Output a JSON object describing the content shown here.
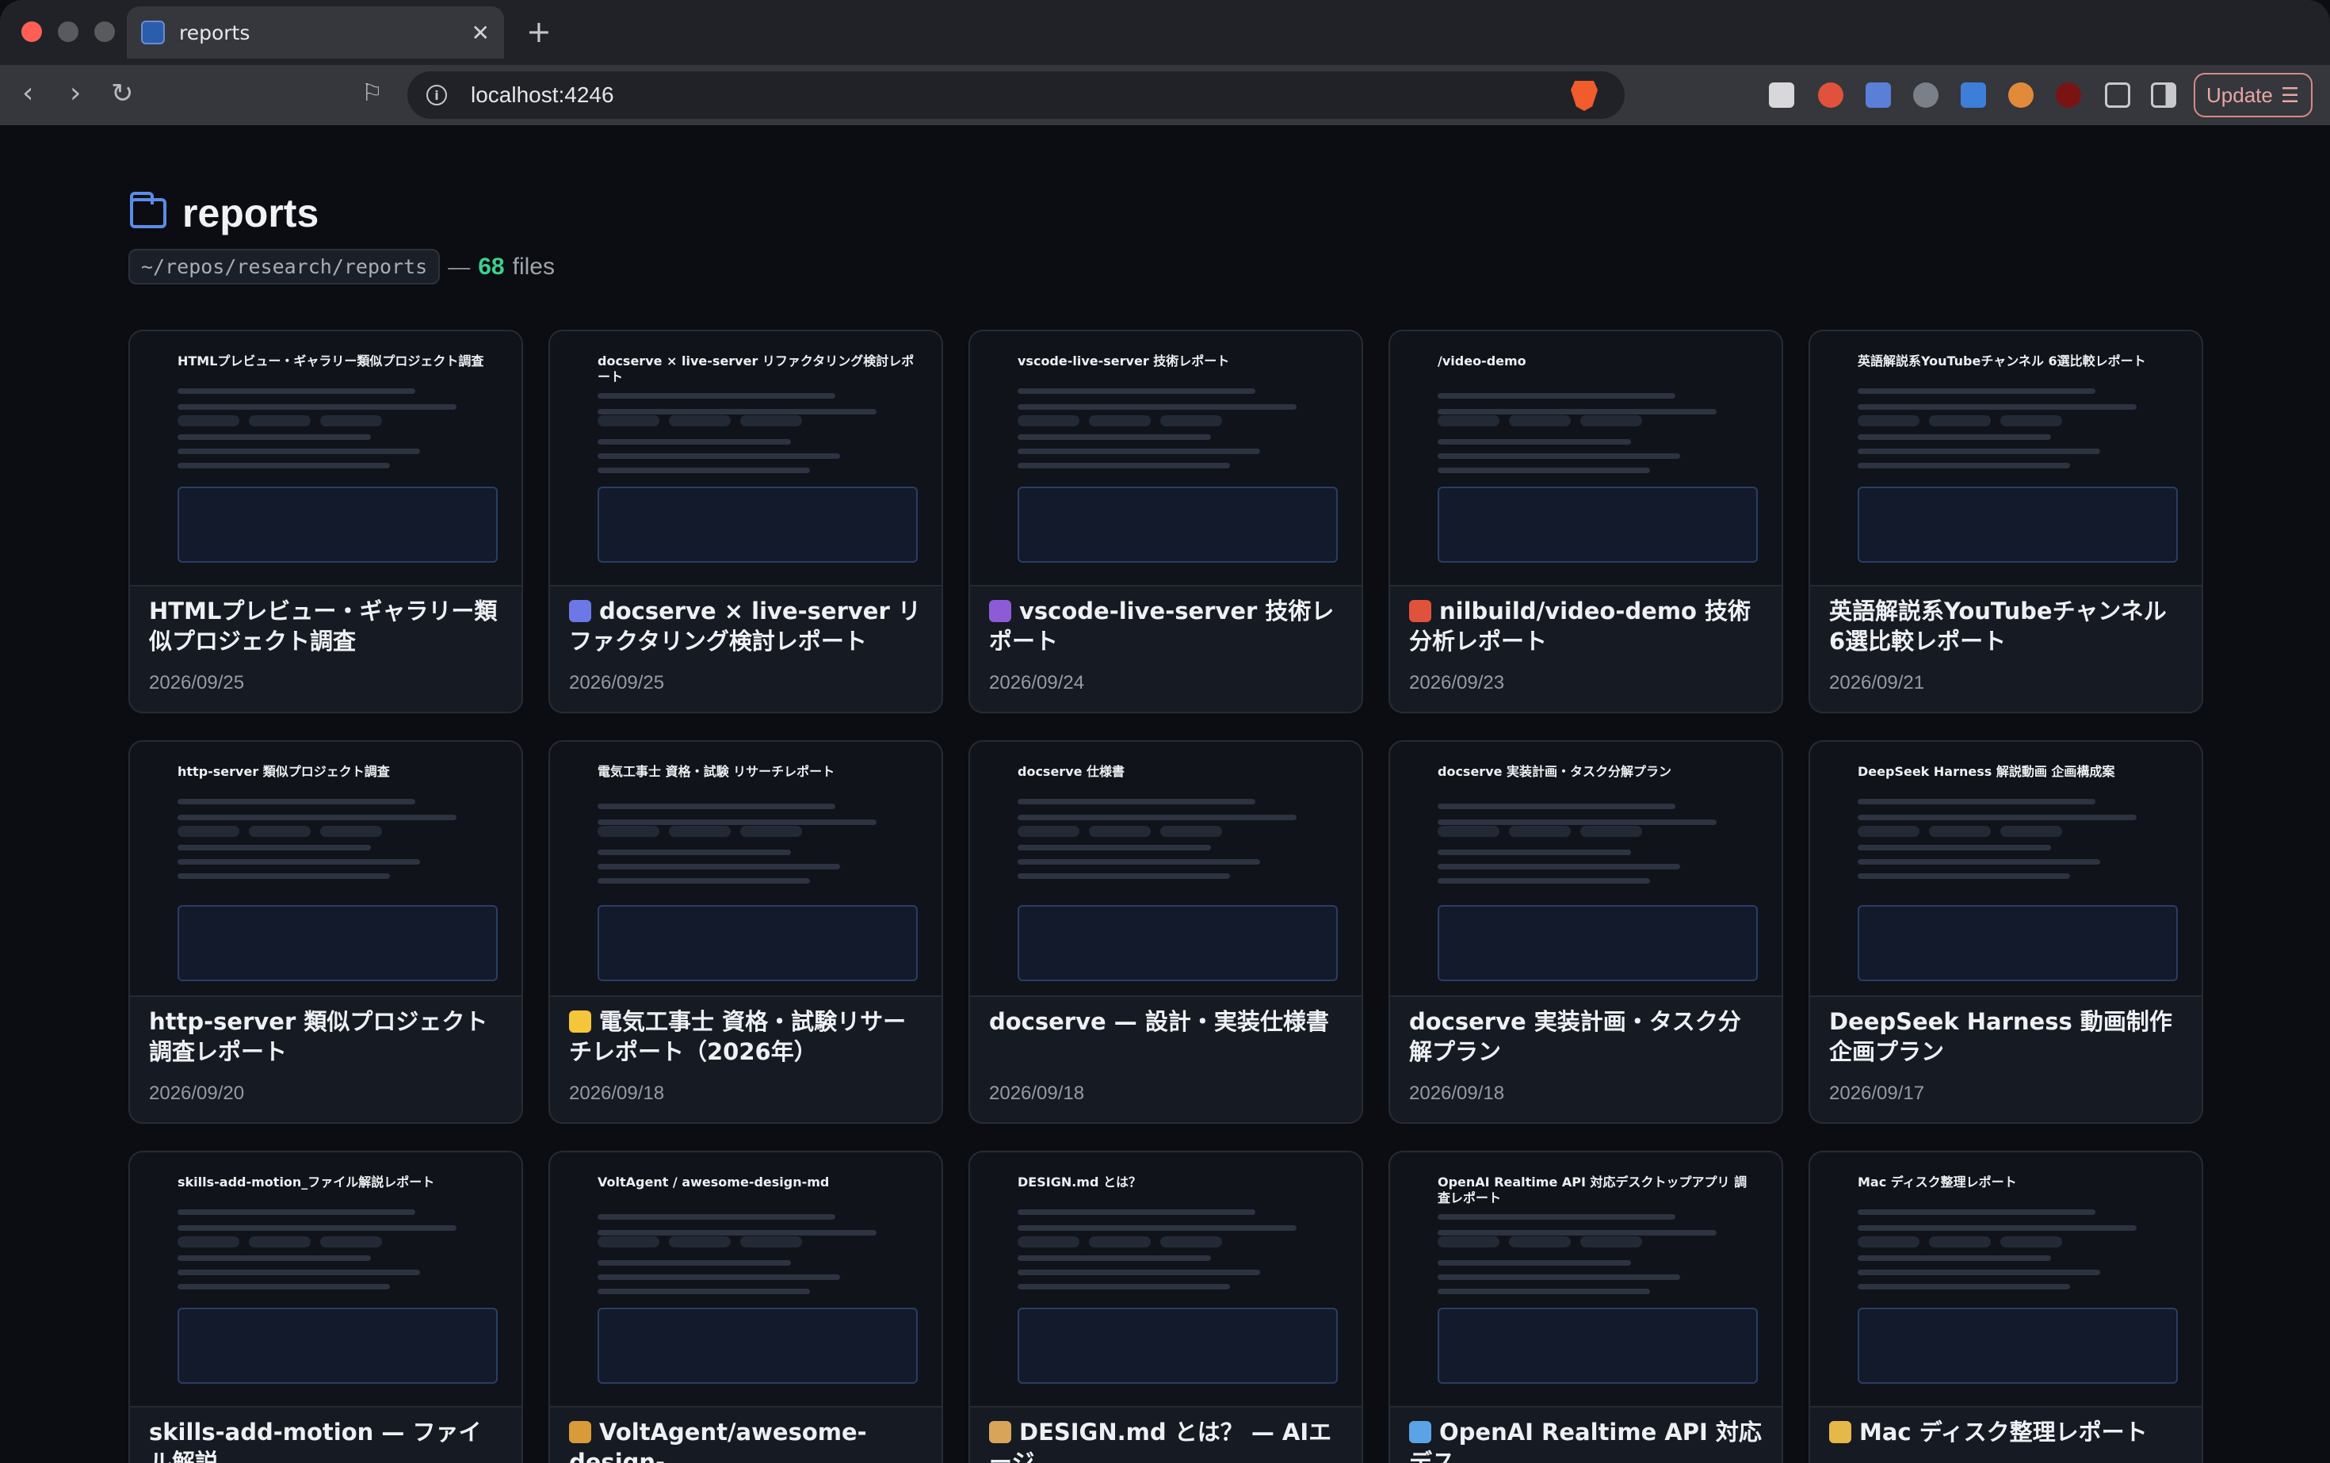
{
  "browser": {
    "tab_title": "reports",
    "url": "localhost:4246",
    "update_label": "Update"
  },
  "page": {
    "title": "reports",
    "path": "~/repos/research/reports",
    "dash": "—",
    "count": "68",
    "files_label": "files"
  },
  "cards": [
    {
      "title": "HTMLプレビュー・ギャラリー類似プロジェクト調査",
      "date": "2026/09/25",
      "thumb_title": "HTMLプレビュー・ギャラリー類似プロジェクト調査",
      "icon": "none",
      "icon_color": ""
    },
    {
      "title": "docserve × live-server リファクタリング検討レポート",
      "date": "2026/09/25",
      "thumb_title": "docserve × live-server リファクタリング検討レポート",
      "icon": "document-icon",
      "icon_color": "#6b78e6"
    },
    {
      "title": "vscode-live-server 技術レポート",
      "date": "2026/09/24",
      "thumb_title": "vscode-live-server 技術レポート",
      "icon": "avatar-icon",
      "icon_color": "#8e5bd6"
    },
    {
      "title": "nilbuild/video-demo 技術分析レポート",
      "date": "2026/09/23",
      "thumb_title": "/video-demo",
      "icon": "clapper-icon",
      "icon_color": "#e0523b"
    },
    {
      "title": "英語解説系YouTubeチャンネル 6選比較レポート",
      "date": "2026/09/21",
      "thumb_title": "英語解説系YouTubeチャンネル 6選比較レポート",
      "icon": "none",
      "icon_color": ""
    },
    {
      "title": "http-server 類似プロジェクト調査レポート",
      "date": "2026/09/20",
      "thumb_title": "http-server 類似プロジェクト調査",
      "icon": "none",
      "icon_color": ""
    },
    {
      "title": "電気工事士 資格・試験リサーチレポート（2026年）",
      "date": "2026/09/18",
      "thumb_title": "電気工事士 資格・試験 リサーチレポート",
      "icon": "lightning-icon",
      "icon_color": "#f5c53a"
    },
    {
      "title": "docserve — 設計・実装仕様書",
      "date": "2026/09/18",
      "thumb_title": "docserve 仕様書",
      "icon": "none",
      "icon_color": ""
    },
    {
      "title": "docserve 実装計画・タスク分解プラン",
      "date": "2026/09/18",
      "thumb_title": "docserve 実装計画・タスク分解プラン",
      "icon": "none",
      "icon_color": ""
    },
    {
      "title": "DeepSeek Harness 動画制作企画プラン",
      "date": "2026/09/17",
      "thumb_title": "DeepSeek Harness 解説動画 企画構成案",
      "icon": "none",
      "icon_color": ""
    },
    {
      "title": "skills-add-motion — ファイル解説",
      "date": "",
      "thumb_title": "skills-add-motion_ファイル解説レポート",
      "icon": "none",
      "icon_color": ""
    },
    {
      "title": "VoltAgent/awesome-design-",
      "date": "",
      "thumb_title": "VoltAgent / awesome-design-md",
      "icon": "books-icon",
      "icon_color": "#d99a3a"
    },
    {
      "title": "DESIGN.md とは？ — AIエージ",
      "date": "",
      "thumb_title": "DESIGN.md とは？",
      "icon": "palette-icon",
      "icon_color": "#d7a45a"
    },
    {
      "title": "OpenAI Realtime API 対応デス",
      "date": "",
      "thumb_title": "OpenAI Realtime API 対応デスクトップアプリ 調査レポート",
      "icon": "target-icon",
      "icon_color": "#5aa3e6"
    },
    {
      "title": "Mac ディスク整理レポート",
      "date": "",
      "thumb_title": "Mac ディスク整理レポート",
      "icon": "disk-icon",
      "icon_color": "#e6b84a"
    }
  ]
}
